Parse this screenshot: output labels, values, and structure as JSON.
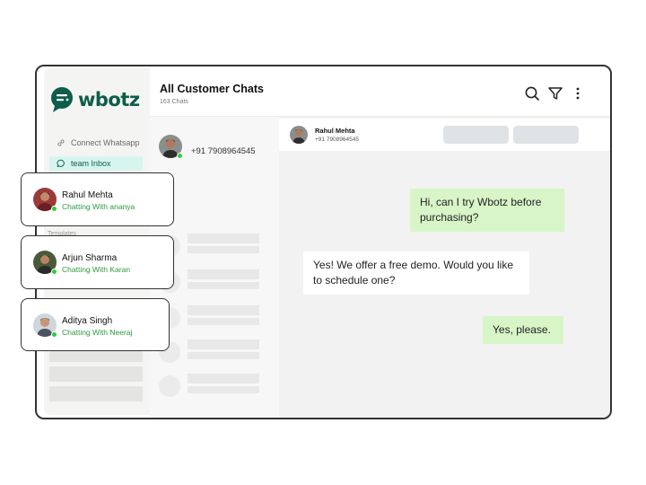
{
  "brand": {
    "name": "wbotz",
    "color": "#0f5c4a"
  },
  "sidebar": {
    "items": [
      {
        "label": "Connect Whatsapp",
        "icon": "link-icon"
      },
      {
        "label": "team Inbox",
        "icon": "chat-bubble-icon",
        "active": true
      }
    ],
    "partial_label": "Templates"
  },
  "header": {
    "title": "All Customer Chats",
    "subtitle": "163 Chats",
    "actions": [
      "search-icon",
      "filter-icon",
      "more-vertical-icon"
    ]
  },
  "chat_list": {
    "selected_phone": "+91 7908964545"
  },
  "conversation": {
    "contact_name": "Rahul Mehta",
    "contact_phone": "+91 7908964545",
    "messages": [
      {
        "direction": "out",
        "text": "Hi, can I try Wbotz before purchasing?"
      },
      {
        "direction": "in",
        "text": "Yes! We offer a free demo. Would you like to schedule one?"
      },
      {
        "direction": "out",
        "text": "Yes, please."
      }
    ]
  },
  "cards": [
    {
      "name": "Rahul Mehta",
      "status": "Chatting With ananya"
    },
    {
      "name": "Arjun Sharma",
      "status": "Chatting With Karan"
    },
    {
      "name": "Aditya Singh",
      "status": "Chatting With Neeraj"
    }
  ],
  "colors": {
    "accent": "#0f5c4a",
    "online": "#2ecc40",
    "outgoing_bubble": "#d8f5c8",
    "status_text": "#2e9a3e"
  }
}
